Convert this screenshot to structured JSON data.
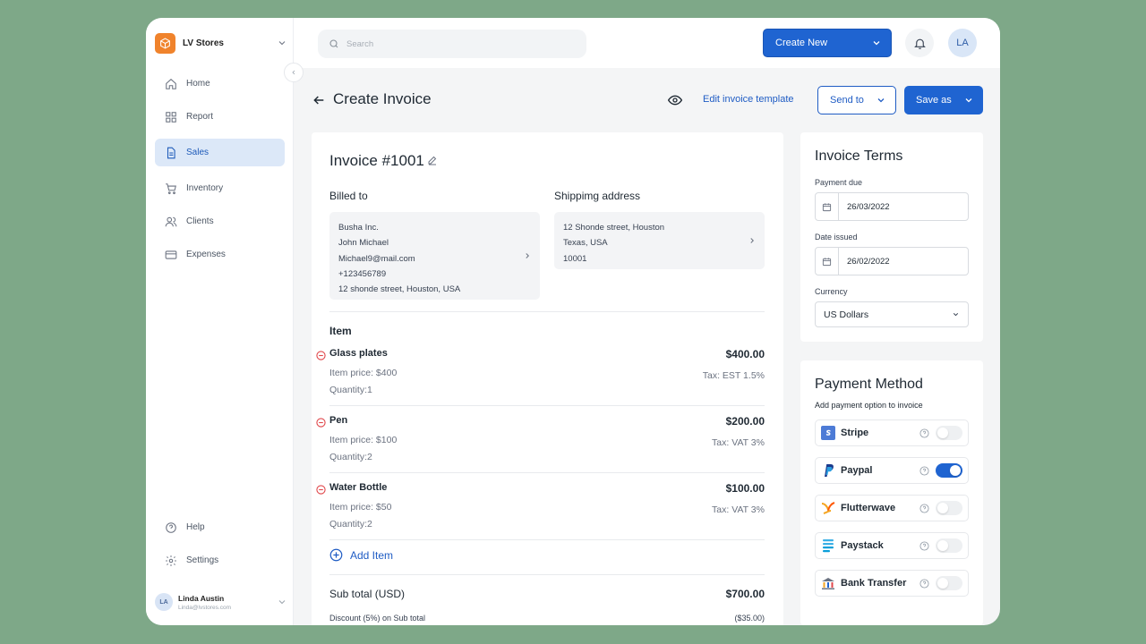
{
  "sidebar": {
    "brand": "LV Stores",
    "items": [
      {
        "label": "Home",
        "icon": "home-icon"
      },
      {
        "label": "Report",
        "icon": "grid-icon"
      },
      {
        "label": "Sales",
        "icon": "document-icon"
      },
      {
        "label": "Inventory",
        "icon": "cart-icon"
      },
      {
        "label": "Clients",
        "icon": "users-icon"
      },
      {
        "label": "Expenses",
        "icon": "card-icon"
      }
    ],
    "bottom": [
      {
        "label": "Help",
        "icon": "help-icon"
      },
      {
        "label": "Settings",
        "icon": "gear-icon"
      }
    ],
    "user": {
      "initials": "LA",
      "name": "Linda Austin",
      "email": "Linda@lvstores.com"
    }
  },
  "topbar": {
    "search_placeholder": "Search",
    "create_new": "Create New",
    "avatar_initials": "LA"
  },
  "page": {
    "title": "Create Invoice",
    "edit_template": "Edit invoice template",
    "send_to": "Send to",
    "save_as": "Save as"
  },
  "invoice": {
    "title": "Invoice #1001",
    "billed_to_label": "Billed to",
    "billed_to": [
      "Busha Inc.",
      "John Michael",
      "Michael9@mail.com",
      "+123456789",
      "12 shonde street, Houston, USA"
    ],
    "shipping_label": "Shippimg address",
    "shipping": [
      "12 Shonde street, Houston",
      "Texas, USA",
      "10001"
    ],
    "item_label": "Item",
    "items": [
      {
        "name": "Glass plates",
        "price": "Item price: $400",
        "qty": "Quantity:1",
        "total": "$400.00",
        "tax": "Tax: EST 1.5%"
      },
      {
        "name": "Pen",
        "price": "Item price: $100",
        "qty": "Quantity:2",
        "total": "$200.00",
        "tax": "Tax: VAT 3%"
      },
      {
        "name": "Water Bottle",
        "price": "Item price: $50",
        "qty": "Quantity:2",
        "total": "$100.00",
        "tax": "Tax: VAT 3%"
      }
    ],
    "add_item": "Add Item",
    "subtotal_label": "Sub total (USD)",
    "subtotal_value": "$700.00",
    "discount_label": "Discount (5%) on Sub total",
    "discount_value": "($35.00)"
  },
  "terms": {
    "title": "Invoice Terms",
    "payment_due_label": "Payment due",
    "payment_due": "26/03/2022",
    "date_issued_label": "Date issued",
    "date_issued": "26/02/2022",
    "currency_label": "Currency",
    "currency": "US Dollars"
  },
  "payment": {
    "title": "Payment Method",
    "subtitle": "Add payment option to invoice",
    "methods": [
      {
        "name": "Stripe",
        "enabled": false
      },
      {
        "name": "Paypal",
        "enabled": true
      },
      {
        "name": "Flutterwave",
        "enabled": false
      },
      {
        "name": "Paystack",
        "enabled": false
      },
      {
        "name": "Bank Transfer",
        "enabled": false
      }
    ]
  },
  "colors": {
    "accent": "#1f64d1",
    "brand": "#f0832c",
    "active_nav_bg": "#dce8f8",
    "background": "#7ea888"
  }
}
